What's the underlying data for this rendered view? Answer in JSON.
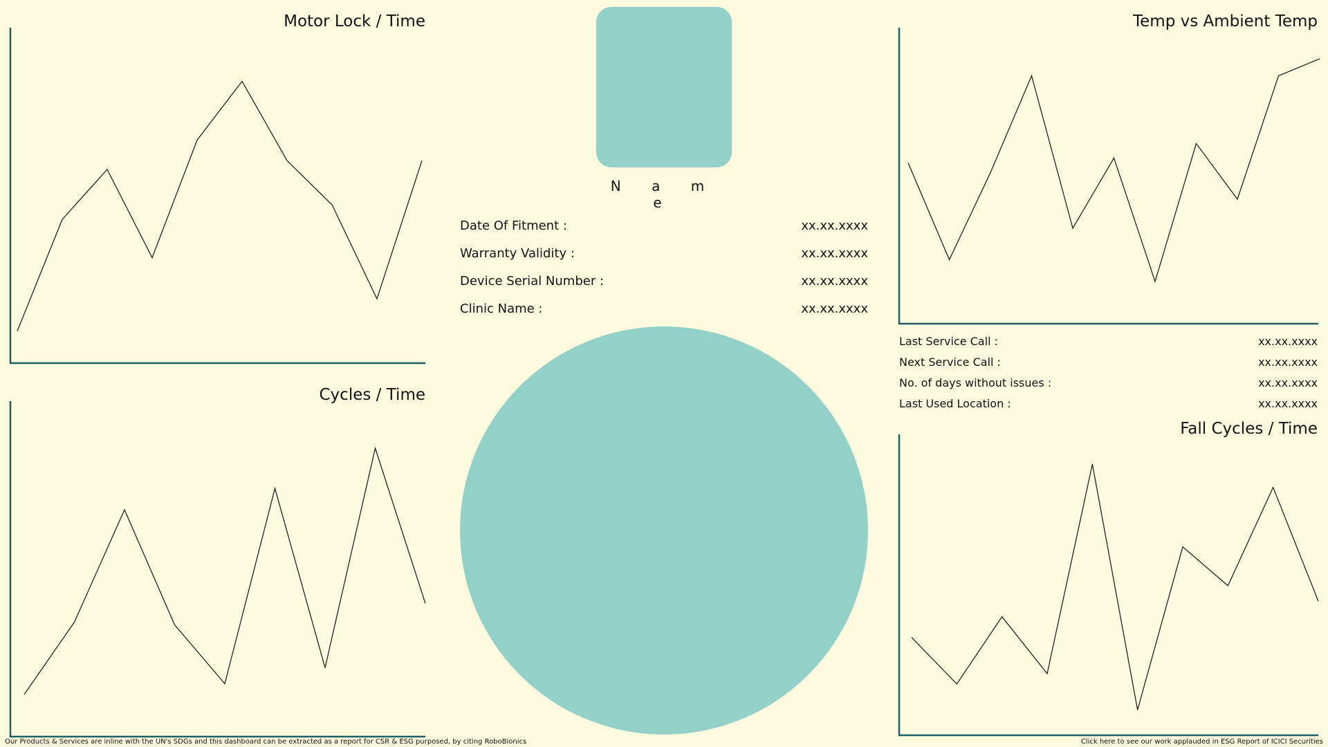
{
  "charts": {
    "motor_lock": {
      "title": "Motor Lock / Time",
      "values": [
        5,
        43,
        60,
        30,
        70,
        90,
        63,
        48,
        16,
        63
      ]
    },
    "cycles": {
      "title": "Cycles / Time",
      "values": [
        8,
        35,
        77,
        34,
        12,
        85,
        18,
        100,
        42
      ]
    },
    "temp_ambient": {
      "title": "Temp vs Ambient Temp",
      "values": [
        57,
        17,
        53,
        93,
        30,
        59,
        8,
        65,
        42,
        93,
        100
      ]
    },
    "fall_cycles": {
      "title": "Fall Cycles / Time",
      "values": [
        33,
        15,
        41,
        19,
        100,
        5,
        68,
        53,
        91,
        47
      ]
    }
  },
  "chart_data": [
    {
      "type": "line",
      "title": "Motor Lock / Time",
      "x": [
        1,
        2,
        3,
        4,
        5,
        6,
        7,
        8,
        9,
        10
      ],
      "values": [
        5,
        43,
        60,
        30,
        70,
        90,
        63,
        48,
        16,
        63
      ]
    },
    {
      "type": "line",
      "title": "Cycles / Time",
      "x": [
        1,
        2,
        3,
        4,
        5,
        6,
        7,
        8,
        9
      ],
      "values": [
        8,
        35,
        77,
        34,
        12,
        85,
        18,
        100,
        42
      ]
    },
    {
      "type": "line",
      "title": "Temp vs Ambient Temp",
      "x": [
        1,
        2,
        3,
        4,
        5,
        6,
        7,
        8,
        9,
        10,
        11
      ],
      "values": [
        57,
        17,
        53,
        93,
        30,
        59,
        8,
        65,
        42,
        93,
        100
      ]
    },
    {
      "type": "line",
      "title": "Fall Cycles / Time",
      "x": [
        1,
        2,
        3,
        4,
        5,
        6,
        7,
        8,
        9,
        10
      ],
      "values": [
        33,
        15,
        41,
        19,
        100,
        5,
        68,
        53,
        91,
        47
      ]
    }
  ],
  "profile": {
    "name": "N a m e"
  },
  "device_info": [
    {
      "label": "Date Of Fitment :",
      "value": "xx.xx.xxxx"
    },
    {
      "label": "Warranty Validity :",
      "value": "xx.xx.xxxx"
    },
    {
      "label": "Device Serial Number :",
      "value": "xx.xx.xxxx"
    },
    {
      "label": "Clinic Name :",
      "value": "xx.xx.xxxx"
    }
  ],
  "service_info": [
    {
      "label": "Last Service Call :",
      "value": "xx.xx.xxxx"
    },
    {
      "label": "Next Service Call :",
      "value": "xx.xx.xxxx"
    },
    {
      "label": "No. of days without issues :",
      "value": "xx.xx.xxxx"
    },
    {
      "label": "Last Used Location :",
      "value": "xx.xx.xxxx"
    }
  ],
  "footer": {
    "left": "Our Products & Services are inline with the UN's SDGs and this dashboard can be extracted as a report for CSR & ESG purposed, by citing RoboBionics",
    "right": "Click here to see our work applauded in ESG Report of ICICI Securities"
  },
  "colors": {
    "background": "#fdfbdf",
    "accent": "#93d0c8",
    "axis": "#1f5f66",
    "line": "#222222"
  }
}
